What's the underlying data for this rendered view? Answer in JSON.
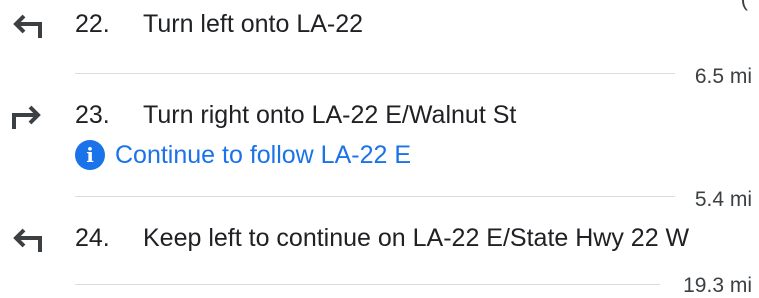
{
  "steps": [
    {
      "number": "22.",
      "instruction": "Turn left onto LA-22",
      "icon": "turn-left-icon",
      "distance": "6.5 mi"
    },
    {
      "number": "23.",
      "instruction": "Turn right onto LA-22 E/Walnut St",
      "icon": "turn-right-icon",
      "note": "Continue to follow LA-22 E",
      "distance": "5.4 mi"
    },
    {
      "number": "24.",
      "instruction": "Keep left to continue on LA-22 E/State Hwy 22 W",
      "icon": "keep-left-icon",
      "distance": "19.3 mi"
    }
  ],
  "colors": {
    "text": "#202124",
    "icon": "#3c4043",
    "link": "#1a73e8",
    "divider": "#dadce0"
  }
}
